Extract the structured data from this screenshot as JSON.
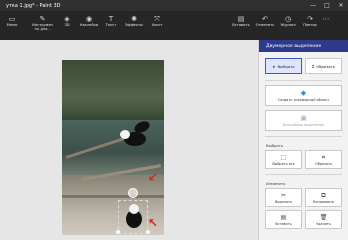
{
  "window": {
    "title": "утка 1.jpg* - Paint 3D",
    "controls": {
      "minimize": "—",
      "maximize": "□",
      "close": "✕"
    }
  },
  "toolbar": {
    "left": [
      {
        "label": "Меню",
        "icon": "folder-icon",
        "glyph": "▭"
      },
      {
        "label": "Инструмен\nты для...",
        "icon": "brush-icon",
        "glyph": "✎"
      },
      {
        "label": "3D",
        "icon": "cube-icon",
        "glyph": "◈"
      },
      {
        "label": "Наклейки",
        "icon": "sticker-icon",
        "glyph": "◉"
      },
      {
        "label": "Текст",
        "icon": "text-icon",
        "glyph": "T"
      },
      {
        "label": "Эффекты",
        "icon": "effects-icon",
        "glyph": "✺"
      },
      {
        "label": "Холст",
        "icon": "canvas-icon",
        "glyph": "⤧"
      }
    ],
    "right": [
      {
        "label": "Вставить",
        "icon": "paste-icon",
        "glyph": "▤"
      },
      {
        "label": "Отменить",
        "icon": "undo-icon",
        "glyph": "↶"
      },
      {
        "label": "Журнал",
        "icon": "history-icon",
        "glyph": "◷"
      },
      {
        "label": "Повтор",
        "icon": "redo-icon",
        "glyph": "↷"
      },
      {
        "label": "",
        "icon": "more-icon",
        "glyph": "⋯"
      }
    ]
  },
  "panel": {
    "title": "Двумерное выделение",
    "select_label": "Выбрать",
    "crop_label": "Обрезать",
    "create_3d_label": "Создать трехмерный объект",
    "magic_select_label": "Волшебное выделение",
    "section_select": "Выбрать",
    "select_all_label": "Выбрать все",
    "crop2_label": "Обрезать",
    "section_edit": "Изменить",
    "cut_label": "Вырезать",
    "copy_label": "Копировать",
    "paste_label": "Вставить",
    "delete_label": "Удалить"
  },
  "colors": {
    "accent": "#2e3a8c",
    "toolbar_bg": "#262626",
    "titlebar_bg": "#2f2f2f"
  }
}
